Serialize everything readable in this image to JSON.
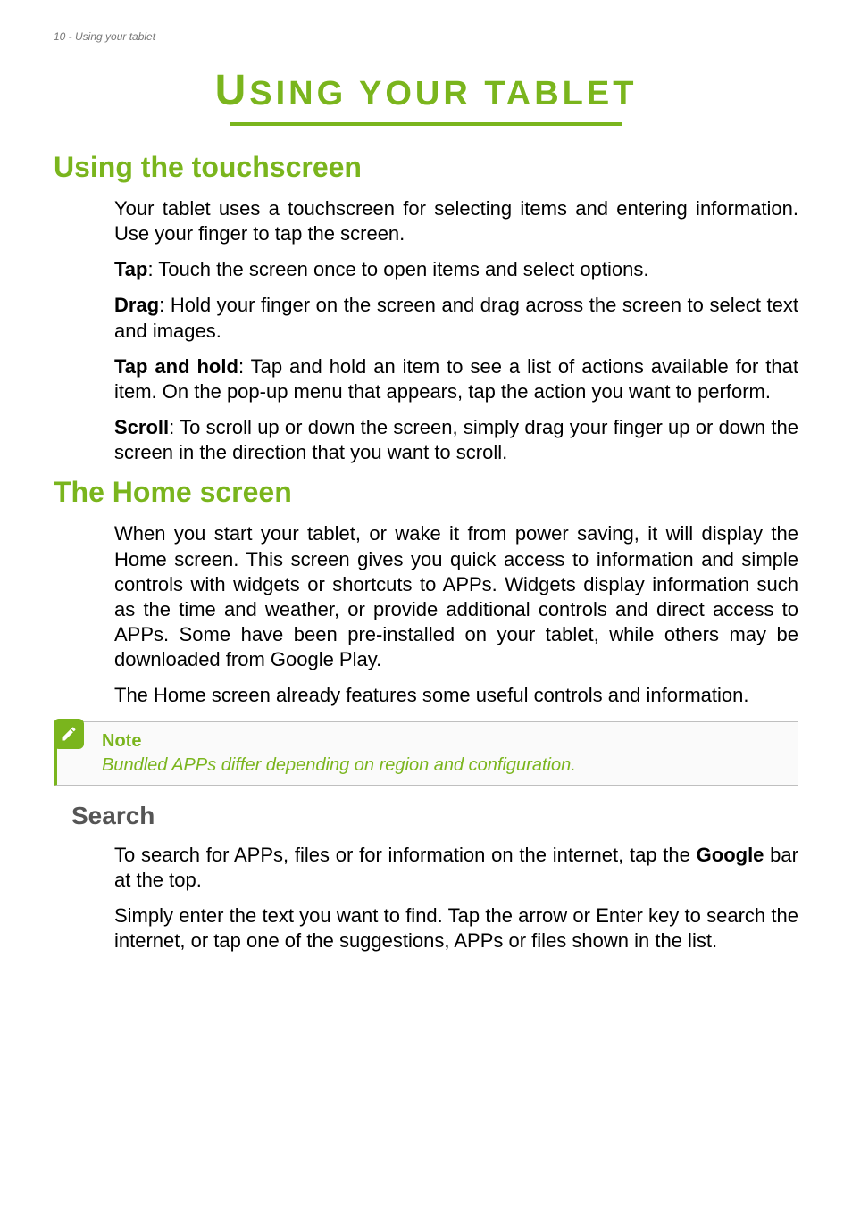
{
  "running_head": "10 - Using your tablet",
  "chapter_title_first": "U",
  "chapter_title_rest": "SING YOUR TABLET",
  "section1": {
    "title": "Using the touchscreen",
    "intro": "Your tablet uses a touchscreen for selecting items and entering information. Use your finger to tap the screen.",
    "tap_label": "Tap",
    "tap_text": ": Touch the screen once to open items and select options.",
    "drag_label": "Drag",
    "drag_text": ": Hold your finger on the screen and drag across the screen to select text and images.",
    "taphold_label": "Tap and hold",
    "taphold_text": ": Tap and hold an item to see a list of actions available for that item. On the pop-up menu that appears, tap the action you want to perform.",
    "scroll_label": "Scroll",
    "scroll_text": ": To scroll up or down the screen, simply drag your finger up or down the screen in the direction that you want to scroll."
  },
  "section2": {
    "title": "The Home screen",
    "para1": "When you start your tablet, or wake it from power saving, it will display the Home screen. This screen gives you quick access to information and simple controls with widgets or shortcuts to APPs. Widgets display information such as the time and weather, or provide additional controls and direct access to APPs. Some have been pre-installed on your tablet, while others may be downloaded from Google Play.",
    "para2": "The Home screen already features some useful controls and information."
  },
  "note": {
    "title": "Note",
    "body": "Bundled APPs differ depending on region and configuration."
  },
  "section3": {
    "title": "Search",
    "para1_a": "To search for APPs, files or for information on the internet, tap the ",
    "para1_bold": "Google",
    "para1_b": "  bar at the top.",
    "para2": "Simply enter the text you want to find. Tap the arrow or Enter key to search the internet, or tap one of the suggestions, APPs or files shown in the list."
  }
}
